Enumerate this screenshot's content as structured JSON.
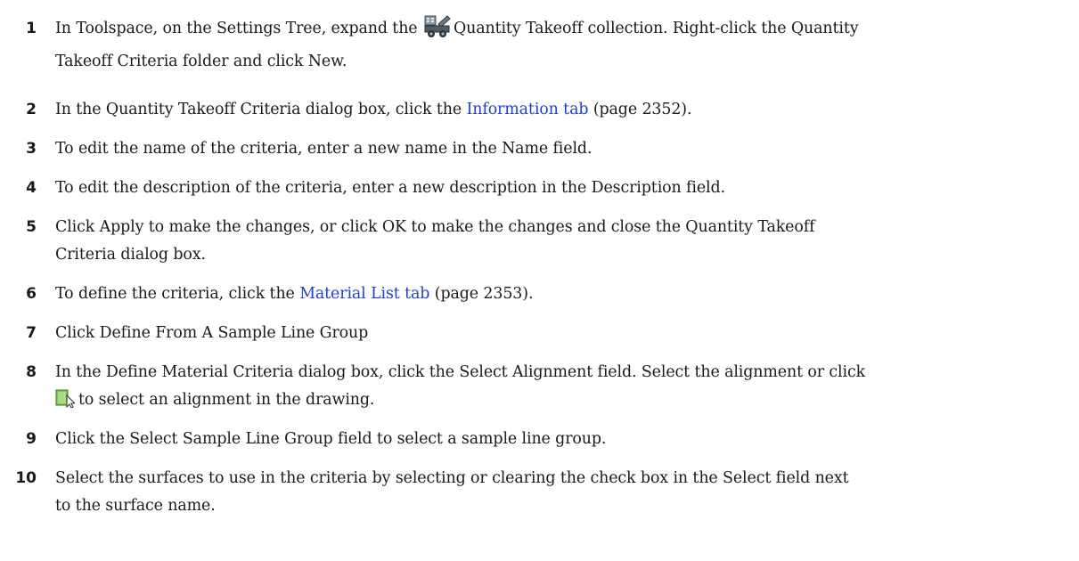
{
  "steps": [
    {
      "number": "1",
      "a": "In Toolspace, on the Settings Tree, expand the",
      "icon": "quantity-takeoff-collection-icon",
      "b": "Quantity Takeoff collection. Right-click the Quantity",
      "c": "Takeoff Criteria folder and click New."
    },
    {
      "number": "2",
      "a": "In the Quantity Takeoff Criteria dialog box, click the",
      "link": "Information tab",
      "b": "(page 2352)."
    },
    {
      "number": "3",
      "text": "To edit the name of the criteria, enter a new name in the Name field."
    },
    {
      "number": "4",
      "text": "To edit the description of the criteria, enter a new description in the Description field."
    },
    {
      "number": "5",
      "a": "Click Apply to make the changes, or click OK to make the changes and close the Quantity Takeoff",
      "b": "Criteria dialog box."
    },
    {
      "number": "6",
      "a": "To define the criteria, click the",
      "link": "Material List tab",
      "b": "(page 2353)."
    },
    {
      "number": "7",
      "text": "Click Define From A Sample Line Group"
    },
    {
      "number": "8",
      "a": "In the Define Material Criteria dialog box, click the Select Alignment field. Select the alignment or click",
      "icon": "pick-from-drawing-icon",
      "b": "to select an alignment in the drawing."
    },
    {
      "number": "9",
      "text": "Click the Select Sample Line Group field to select a sample line group."
    },
    {
      "number": "10",
      "a": "Select the surfaces to use in the criteria by selecting or clearing the check box in the Select field next",
      "b": "to the surface name."
    }
  ],
  "colors": {
    "link": "#1f3fd0",
    "text": "#1a1a1a"
  }
}
